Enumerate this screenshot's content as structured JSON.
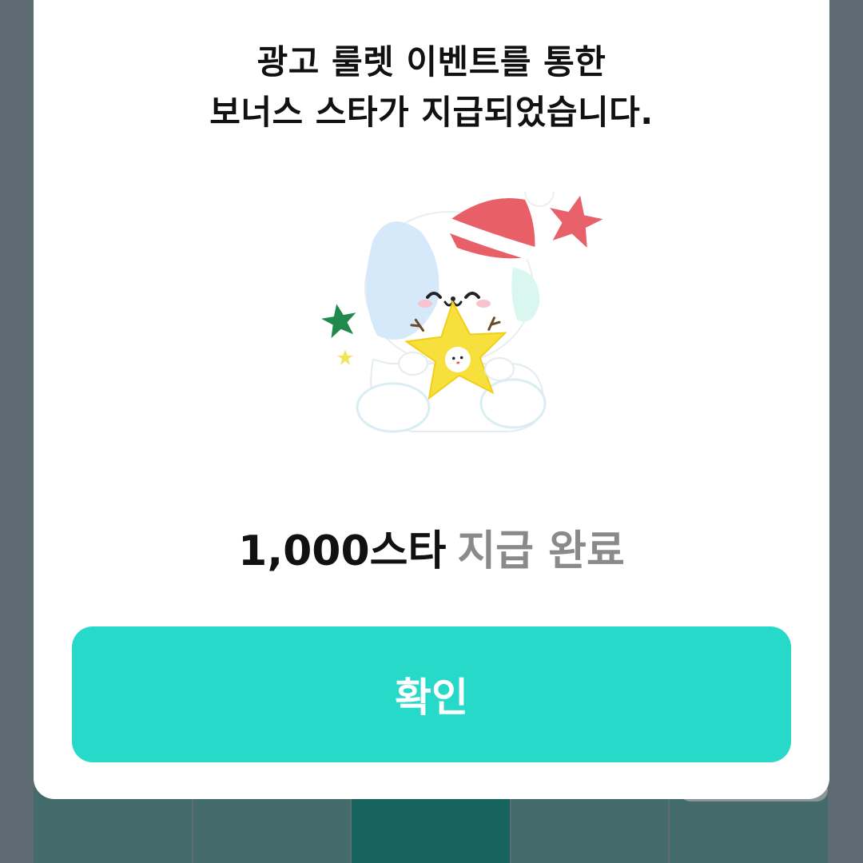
{
  "modal": {
    "title_line1": "광고 룰렛 이벤트를 통한",
    "title_line2": "보너스 스타가 지급되었습니다.",
    "amount": "1,000스타",
    "status": "지급 완료",
    "confirm_label": "확인",
    "illustration": "puppy-with-santa-hat-holding-star"
  },
  "colors": {
    "button": "#27d9c8",
    "amount_text": "#111111",
    "status_text": "#8a8a8a",
    "overlay": "#5f6b72"
  }
}
